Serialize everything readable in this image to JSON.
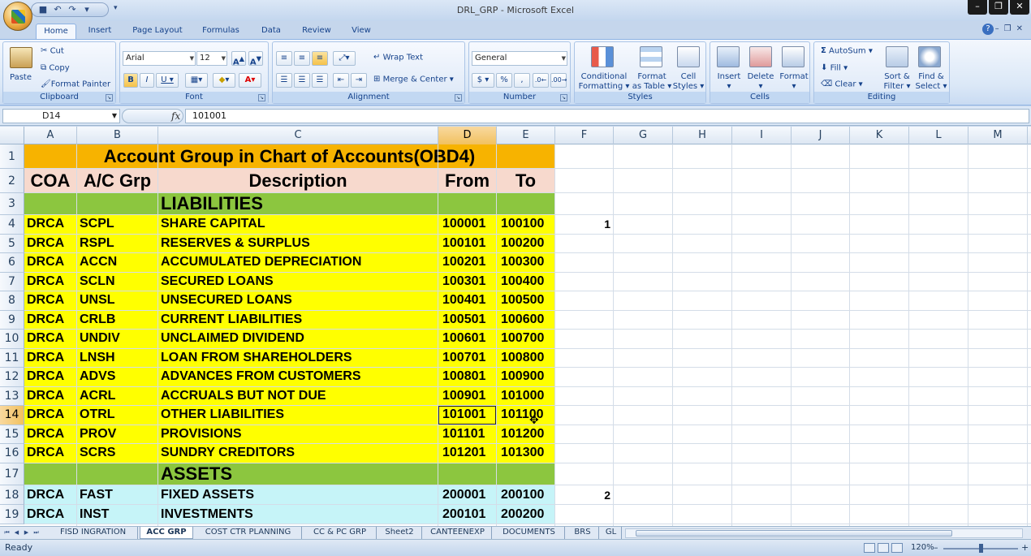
{
  "window": {
    "title": "DRL_GRP - Microsoft Excel"
  },
  "ribbon_tabs": [
    "Home",
    "Insert",
    "Page Layout",
    "Formulas",
    "Data",
    "Review",
    "View"
  ],
  "ribbon": {
    "clipboard": {
      "label": "Clipboard",
      "paste": "Paste",
      "cut": "Cut",
      "copy": "Copy",
      "format_painter": "Format Painter"
    },
    "font": {
      "label": "Font",
      "font_name": "Arial",
      "font_size": "12"
    },
    "alignment": {
      "label": "Alignment",
      "wrap_text": "Wrap Text",
      "merge_center": "Merge & Center"
    },
    "number": {
      "label": "Number",
      "format": "General"
    },
    "styles": {
      "label": "Styles",
      "conditional_l1": "Conditional",
      "conditional_l2": "Formatting",
      "format_table_l1": "Format",
      "format_table_l2": "as Table",
      "cell_styles_l1": "Cell",
      "cell_styles_l2": "Styles"
    },
    "cells": {
      "label": "Cells",
      "insert": "Insert",
      "delete": "Delete",
      "format": "Format"
    },
    "editing": {
      "label": "Editing",
      "autosum": "AutoSum",
      "fill": "Fill",
      "clear": "Clear",
      "sort_l1": "Sort &",
      "sort_l2": "Filter",
      "find_l1": "Find &",
      "find_l2": "Select"
    }
  },
  "formula_bar": {
    "name_box": "D14",
    "fx": "fx",
    "value": "101001"
  },
  "columns": [
    "A",
    "B",
    "C",
    "D",
    "E",
    "F",
    "G",
    "H",
    "I",
    "J",
    "K",
    "L",
    "M"
  ],
  "rows": [
    "1",
    "2",
    "3",
    "4",
    "5",
    "6",
    "7",
    "8",
    "9",
    "10",
    "11",
    "12",
    "13",
    "14",
    "15",
    "16",
    "17",
    "18",
    "19"
  ],
  "sheet": {
    "title": "Account Group in Chart of Accounts(OBD4)",
    "headers": [
      "COA",
      "A/C Grp",
      "Description",
      "From",
      "To"
    ],
    "liabilities_label": "LIABILITIES",
    "assets_label": "ASSETS",
    "liabilities": [
      [
        "DRCA",
        "SCPL",
        "SHARE CAPITAL",
        "100001",
        "100100"
      ],
      [
        "DRCA",
        "RSPL",
        "RESERVES & SURPLUS",
        "100101",
        "100200"
      ],
      [
        "DRCA",
        "ACCN",
        "ACCUMULATED DEPRECIATION",
        "100201",
        "100300"
      ],
      [
        "DRCA",
        "SCLN",
        "SECURED LOANS",
        "100301",
        "100400"
      ],
      [
        "DRCA",
        "UNSL",
        "UNSECURED LOANS",
        "100401",
        "100500"
      ],
      [
        "DRCA",
        "CRLB",
        "CURRENT LIABILITIES",
        "100501",
        "100600"
      ],
      [
        "DRCA",
        "UNDIV",
        "UNCLAIMED DIVIDEND",
        "100601",
        "100700"
      ],
      [
        "DRCA",
        "LNSH",
        "LOAN FROM SHAREHOLDERS",
        "100701",
        "100800"
      ],
      [
        "DRCA",
        "ADVS",
        "ADVANCES FROM CUSTOMERS",
        "100801",
        "100900"
      ],
      [
        "DRCA",
        "ACRL",
        "ACCRUALS BUT NOT DUE",
        "100901",
        "101000"
      ],
      [
        "DRCA",
        "OTRL",
        "OTHER LIABILITIES",
        "101001",
        "101100"
      ],
      [
        "DRCA",
        "PROV",
        "PROVISIONS",
        "101101",
        "101200"
      ],
      [
        "DRCA",
        "SCRS",
        "SUNDRY CREDITORS",
        "101201",
        "101300"
      ]
    ],
    "assets": [
      [
        "DRCA",
        "FAST",
        "FIXED ASSETS",
        "200001",
        "200100"
      ],
      [
        "DRCA",
        "INST",
        "INVESTMENTS",
        "200101",
        "200200"
      ]
    ],
    "f4": "1",
    "f18": "2"
  },
  "sheet_tabs": [
    "FISD INGRATION",
    "ACC GRP",
    "COST CTR PLANNING",
    "CC & PC GRP",
    "Sheet2",
    "CANTEENEXP",
    "DOCUMENTS",
    "BRS",
    "GL"
  ],
  "status": {
    "text": "Ready",
    "zoom": "120%"
  }
}
